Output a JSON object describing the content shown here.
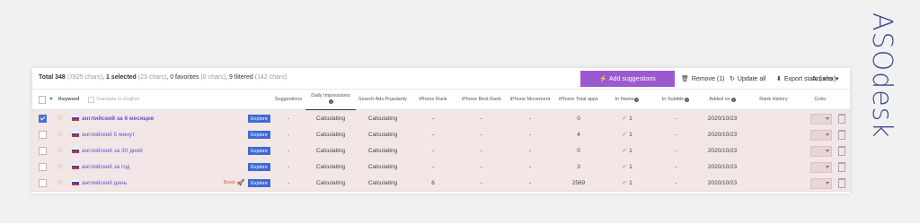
{
  "brand": "ASOdesk",
  "summary": {
    "total": "Total 348",
    "total_chars": "(7825 chars)",
    "selected": "1 selected",
    "selected_chars": "(23 chars)",
    "favorites": "0 favorites",
    "favorites_chars": "(0 chars)",
    "filtered": "9 filtered",
    "filtered_chars": "(142 chars)"
  },
  "toolbar": {
    "add_suggestions": "Add suggestions",
    "remove": "Remove (1)",
    "update_all": "Update all",
    "export": "Export stats (.xlsx)",
    "actions": "Actions"
  },
  "headers": {
    "keyword": "Keyword",
    "translate": "Translate to English",
    "suggestions": "Suggestions",
    "daily_impressions": "Daily Impressions",
    "search_ads": "Search Ads Popularity",
    "iphone_rank": "iPhone Rank",
    "iphone_best_rank": "iPhone Best Rank",
    "iphone_movement": "iPhone Movement",
    "iphone_total_apps": "iPhone Total apps",
    "in_name": "In Name",
    "in_subtitle": "In Subtitle",
    "added_on": "Added on",
    "rank_history": "Rank History",
    "color": "Color"
  },
  "rows": [
    {
      "keyword": "английский за 6 месяцев",
      "bold": true,
      "checked": true,
      "explore": "Explore",
      "suggestions": "-",
      "daily": "Calculating",
      "popularity": "Calculating",
      "rank": "-",
      "best_rank": "-",
      "movement": "-",
      "total_apps": "0",
      "in_name": "1",
      "in_subtitle": "-",
      "added_on": "2020/10/23"
    },
    {
      "keyword": "английский 5 минут",
      "bold": false,
      "checked": false,
      "explore": "Explore",
      "suggestions": "-",
      "daily": "Calculating",
      "popularity": "Calculating",
      "rank": "-",
      "best_rank": "-",
      "movement": "-",
      "total_apps": "4",
      "in_name": "1",
      "in_subtitle": "-",
      "added_on": "2020/10/23"
    },
    {
      "keyword": "английский за 30 дней",
      "bold": false,
      "checked": false,
      "explore": "Explore",
      "suggestions": "-",
      "daily": "Calculating",
      "popularity": "Calculating",
      "rank": "-",
      "best_rank": "-",
      "movement": "-",
      "total_apps": "0",
      "in_name": "1",
      "in_subtitle": "-",
      "added_on": "2020/10/23"
    },
    {
      "keyword": "английский за год",
      "bold": false,
      "checked": false,
      "explore": "Explore",
      "suggestions": "-",
      "daily": "Calculating",
      "popularity": "Calculating",
      "rank": "-",
      "best_rank": "-",
      "movement": "-",
      "total_apps": "3",
      "in_name": "1",
      "in_subtitle": "-",
      "added_on": "2020/10/23"
    },
    {
      "keyword": "английский день",
      "bold": false,
      "checked": false,
      "explore": "Explore",
      "boost": "Boost",
      "suggestions": "-",
      "daily": "Calculating",
      "popularity": "Calculating",
      "rank": "6",
      "best_rank": "-",
      "movement": "-",
      "total_apps": "2569",
      "in_name": "1",
      "in_subtitle": "-",
      "added_on": "2020/10/23"
    }
  ],
  "colors": {
    "accent": "#9b59d0",
    "explore": "#3d6ad6",
    "row_bg": "#f3e6e6",
    "brand": "#3b4a8a"
  }
}
